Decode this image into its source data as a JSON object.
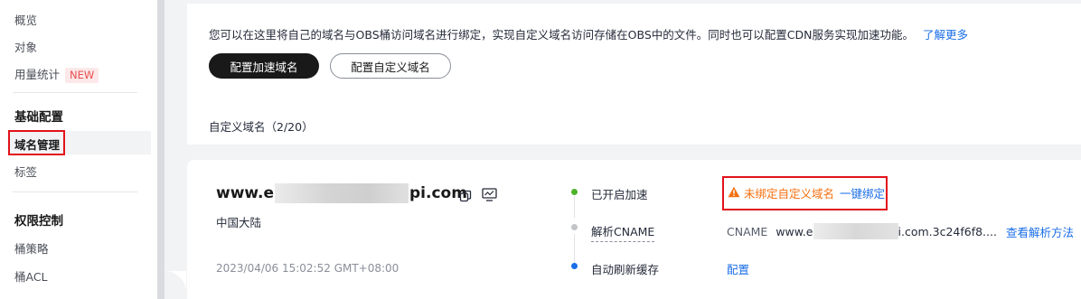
{
  "sidebar": {
    "items_top": [
      {
        "label": "概览"
      },
      {
        "label": "对象"
      },
      {
        "label": "用量统计",
        "badge": "NEW"
      }
    ],
    "group_basic": "基础配置",
    "items_basic": [
      {
        "label": "域名管理"
      },
      {
        "label": "标签"
      }
    ],
    "group_acl": "权限控制",
    "items_acl": [
      {
        "label": "桶策略"
      },
      {
        "label": "桶ACL"
      }
    ]
  },
  "intro": {
    "description": "您可以在这里将自己的域名与OBS桶访问域名进行绑定，实现自定义域名访问存储在OBS中的文件。同时也可以配置CDN服务实现加速功能。",
    "learn_more": "了解更多",
    "btn_accel": "配置加速域名",
    "btn_custom": "配置自定义域名",
    "count_label": "自定义域名（2/20）"
  },
  "domain_card": {
    "domain_prefix": "www.e",
    "domain_suffix": "pi.com",
    "region": "中国大陆",
    "created": "2023/04/06 15:02:52 GMT+08:00",
    "steps": [
      {
        "label": "已开启加速",
        "status_color": "#50b12a"
      },
      {
        "label": "解析CNAME",
        "status_color": "#c2c4c8"
      },
      {
        "label": "自动刷新缓存",
        "status_color": "#1a6ee8"
      }
    ],
    "warning_text": "未绑定自定义域名",
    "bind_link": "一键绑定",
    "cname_label": "CNAME",
    "cname_prefix": "www.e",
    "cname_suffix": "i.com.3c24f6f8....",
    "view_resolution": "查看解析方法",
    "config_link": "配置"
  }
}
